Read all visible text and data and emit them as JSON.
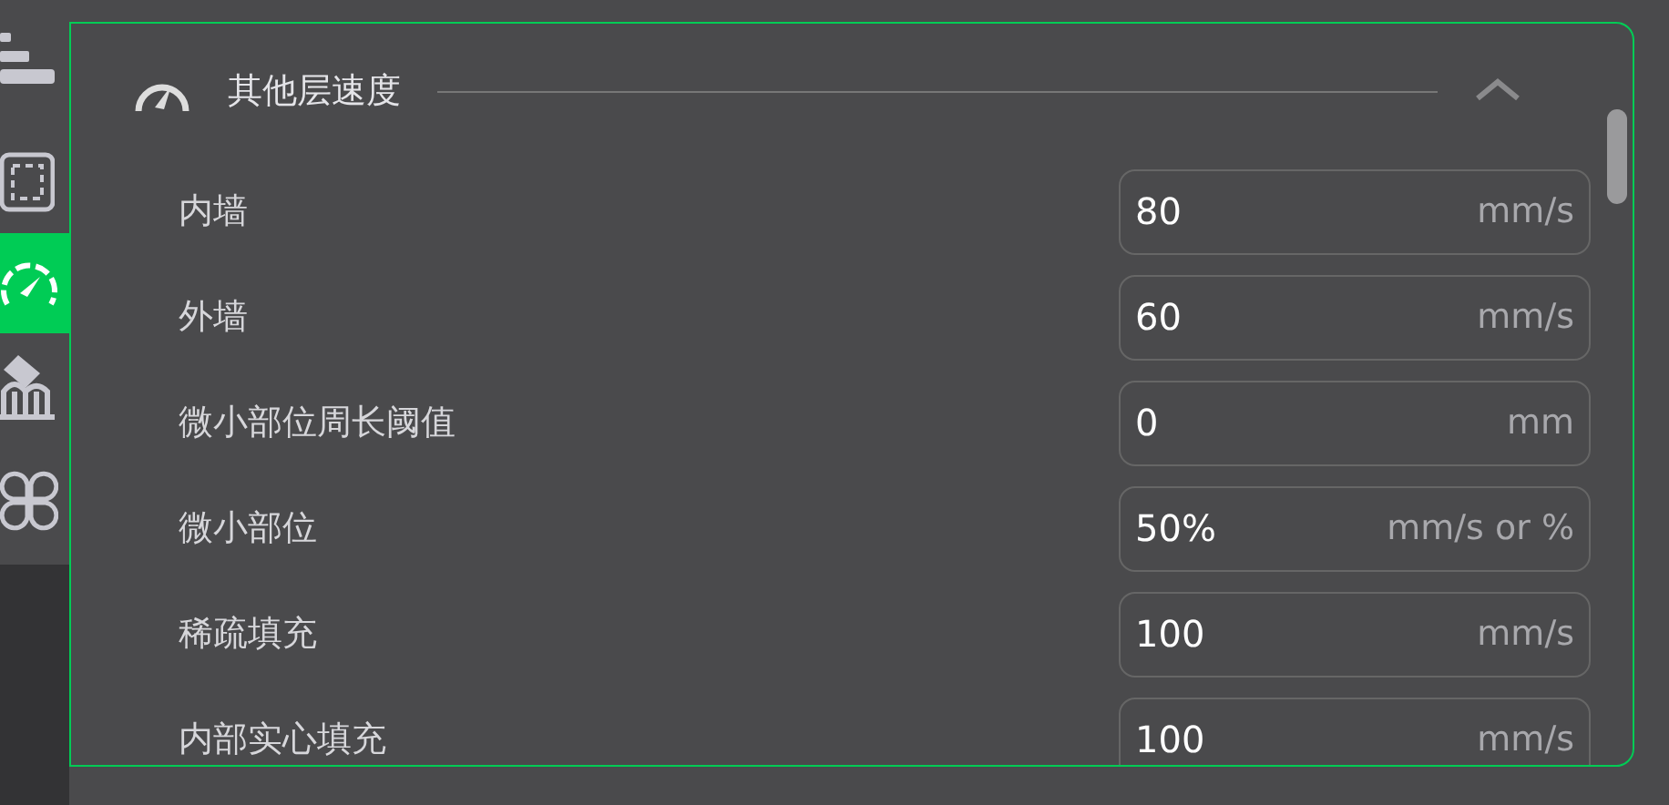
{
  "sidebar": {
    "tabs": [
      {
        "kind": "layers",
        "selected": false
      },
      {
        "kind": "frame",
        "selected": false
      },
      {
        "kind": "speed",
        "selected": true
      },
      {
        "kind": "support",
        "selected": false
      },
      {
        "kind": "others",
        "selected": false
      }
    ]
  },
  "section": {
    "title": "其他层速度",
    "expanded": true,
    "rows": [
      {
        "label": "内墙",
        "value": "80",
        "unit": "mm/s"
      },
      {
        "label": "外墙",
        "value": "60",
        "unit": "mm/s"
      },
      {
        "label": "微小部位周长阈值",
        "value": "0",
        "unit": "mm"
      },
      {
        "label": "微小部位",
        "value": "50%",
        "unit": "mm/s or %"
      },
      {
        "label": "稀疏填充",
        "value": "100",
        "unit": "mm/s"
      },
      {
        "label": "内部实心填充",
        "value": "100",
        "unit": "mm/s"
      }
    ]
  }
}
